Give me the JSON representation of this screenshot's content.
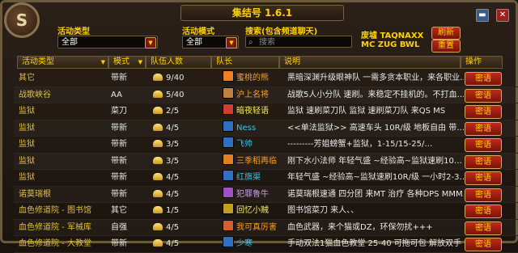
{
  "header": {
    "title": "集结号 1.6.1"
  },
  "portrait": {
    "glyph": "S"
  },
  "filters": {
    "activity_type_label": "活动类型",
    "activity_type_value": "全部",
    "activity_mode_label": "活动模式",
    "activity_mode_value": "全部",
    "search_label": "搜索(包含频道聊天)",
    "search_placeholder": "搜索"
  },
  "right_panel": {
    "line1": "废墟 TAQNAXX",
    "line2": "MC ZUG BWL",
    "refresh_label": "刷新",
    "reset_label": "重置"
  },
  "columns": {
    "type": "活动类型",
    "mode": "模式",
    "count": "队伍人数",
    "leader": "队长",
    "desc": "说明",
    "action": "操作"
  },
  "rows": [
    {
      "type": "其它",
      "mode": "带新",
      "count": "9/40",
      "leader": "蜜桃的熊",
      "leader_color": "#f0a030",
      "class_color": "#f08020",
      "desc": "黑暗深渊升级眼神队 一需多贪本职业，来各职业…",
      "action": "密语"
    },
    {
      "type": "战歌峡谷",
      "mode": "AA",
      "count": "5/40",
      "leader": "沪上名将",
      "leader_color": "#f0a030",
      "class_color": "#c08040",
      "desc": "战歌5人小分队 速刷。来稳定不挂机的。不打血…",
      "action": "密语"
    },
    {
      "type": "监狱",
      "mode": "菜刀",
      "count": "2/5",
      "leader": "暗夜轻语",
      "leader_color": "#f8f060",
      "class_color": "#d04030",
      "desc": "监狱 速刷菜刀队 监狱 速刷菜刀队 来QS MS",
      "action": "密语"
    },
    {
      "type": "监狱",
      "mode": "带新",
      "count": "4/5",
      "leader": "Ness",
      "leader_color": "#40c0e0",
      "class_color": "#3070c0",
      "desc": "<<单法监狱>> 高速车头 10R/级 地板自由 带…",
      "action": "密语"
    },
    {
      "type": "监狱",
      "mode": "带新",
      "count": "3/5",
      "leader": "飞帅",
      "leader_color": "#40c0e0",
      "class_color": "#3070c0",
      "desc": "---------芳姐螃蟹+监狱，1-15/15-25/…",
      "action": "密语"
    },
    {
      "type": "监狱",
      "mode": "带新",
      "count": "3/5",
      "leader": "三季稻再临",
      "leader_color": "#f0a030",
      "class_color": "#e08020",
      "desc": "刚下水小法师 年轻气盛 ~经验高~监狱速刷10…",
      "action": "密语"
    },
    {
      "type": "监狱",
      "mode": "带新",
      "count": "4/5",
      "leader": "红旗渠",
      "leader_color": "#40c0e0",
      "class_color": "#3070c0",
      "desc": "年轻气盛 ~经验高~监狱速刷10R/级 一小时2-3…",
      "action": "密语"
    },
    {
      "type": "诺莫瑞根",
      "mode": "带新",
      "count": "4/5",
      "leader": "犯罪鲁牛",
      "leader_color": "#c8a0e0",
      "class_color": "#a050c0",
      "desc": "诺莫瑞根速通 四分团 来MT 治疗 各种DPS MMM…",
      "action": "密语"
    },
    {
      "type": "血色修道院 - 图书馆",
      "mode": "其它",
      "count": "1/5",
      "leader": "回忆小贼",
      "leader_color": "#f8f060",
      "class_color": "#c0a020",
      "desc": "图书馆菜刀 来人、、",
      "action": "密语"
    },
    {
      "type": "血色修道院 - 军械库",
      "mode": "自强",
      "count": "4/5",
      "leader": "我可真厉害",
      "leader_color": "#f0a030",
      "class_color": "#d06030",
      "desc": "血色武器，来个猫或DZ，环保勿扰+++",
      "action": "密语"
    },
    {
      "type": "血色修道院 - 大教堂",
      "mode": "带新",
      "count": "4/5",
      "leader": "少寒",
      "leader_color": "#40c0e0",
      "class_color": "#3070c0",
      "desc": "手动双法1猫血色教堂 25-40 可拖可包 解放双手",
      "action": "密语"
    }
  ]
}
